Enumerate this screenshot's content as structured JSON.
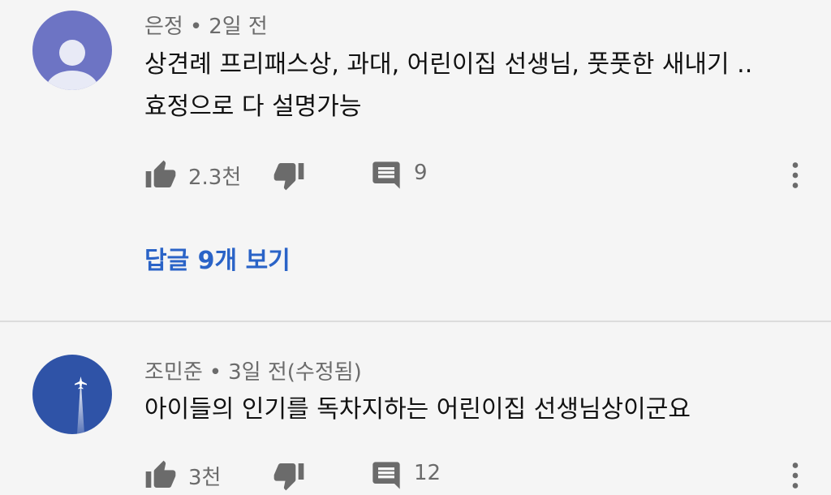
{
  "comments": [
    {
      "author": "은정",
      "separator": "•",
      "time": "2일 전",
      "text_lines": [
        "상견례 프리패스상, 과대, 어린이집 선생님, 풋풋한 새내기 ..",
        "효정으로 다 설명가능"
      ],
      "likes": "2.3천",
      "replies_count": "9",
      "view_replies_label": "답글 9개 보기",
      "avatar_color": "#6d74c4",
      "avatar_icon": "default-person-icon"
    },
    {
      "author": "조민준",
      "separator": "•",
      "time": "3일 전(수정됨)",
      "text_lines": [
        "아이들의 인기를 독차지하는 어린이집 선생님상이군요"
      ],
      "likes": "3천",
      "replies_count": "12",
      "avatar_color": "#2f53a7",
      "avatar_icon": "airplane-contrail-icon"
    }
  ],
  "colors": {
    "background": "#f5f5f5",
    "meta_text": "#6b6b6b",
    "body_text": "#111111",
    "link": "#2a63c7",
    "icon": "#6b6b6b",
    "divider": "#dcdcdc"
  },
  "icons": {
    "like": "thumb-up-icon",
    "dislike": "thumb-down-icon",
    "reply": "comment-icon",
    "more": "more-vert-icon"
  }
}
